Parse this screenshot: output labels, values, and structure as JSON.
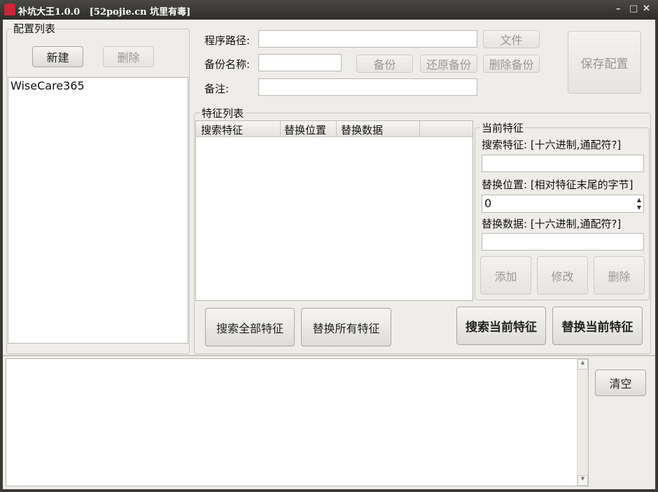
{
  "window": {
    "title": "补坑大王1.0.0   [52pojie.cn 坑里有毒]",
    "minimize": "–",
    "maximize": "□",
    "close": "✕"
  },
  "config": {
    "group_label": "配置列表",
    "new_button": "新建",
    "delete_button": "删除",
    "items": [
      "WiseCare365"
    ]
  },
  "form": {
    "path_label": "程序路径:",
    "path_value": "",
    "file_button": "文件",
    "backup_name_label": "备份名称:",
    "backup_name_value": "",
    "backup_button": "备份",
    "restore_button": "还原备份",
    "delete_backup_button": "删除备份",
    "note_label": "备注:",
    "note_value": "",
    "save_button": "保存配置"
  },
  "features": {
    "group_label": "特征列表",
    "columns": [
      "搜索特征",
      "替换位置",
      "替换数据",
      ""
    ],
    "rows": []
  },
  "current": {
    "group_label": "当前特征",
    "search_label": "搜索特征: [十六进制,通配符?]",
    "search_value": "",
    "offset_label": "替换位置: [相对特征末尾的字节]",
    "offset_value": "0",
    "replace_label": "替换数据: [十六进制,通配符?]",
    "replace_value": "",
    "add_button": "添加",
    "modify_button": "修改",
    "delete_button": "删除"
  },
  "actions": {
    "search_all": "搜索全部特征",
    "replace_all": "替换所有特征",
    "search_current": "搜索当前特征",
    "replace_current": "替换当前特征"
  },
  "log": {
    "text": "",
    "clear_button": "清空"
  }
}
